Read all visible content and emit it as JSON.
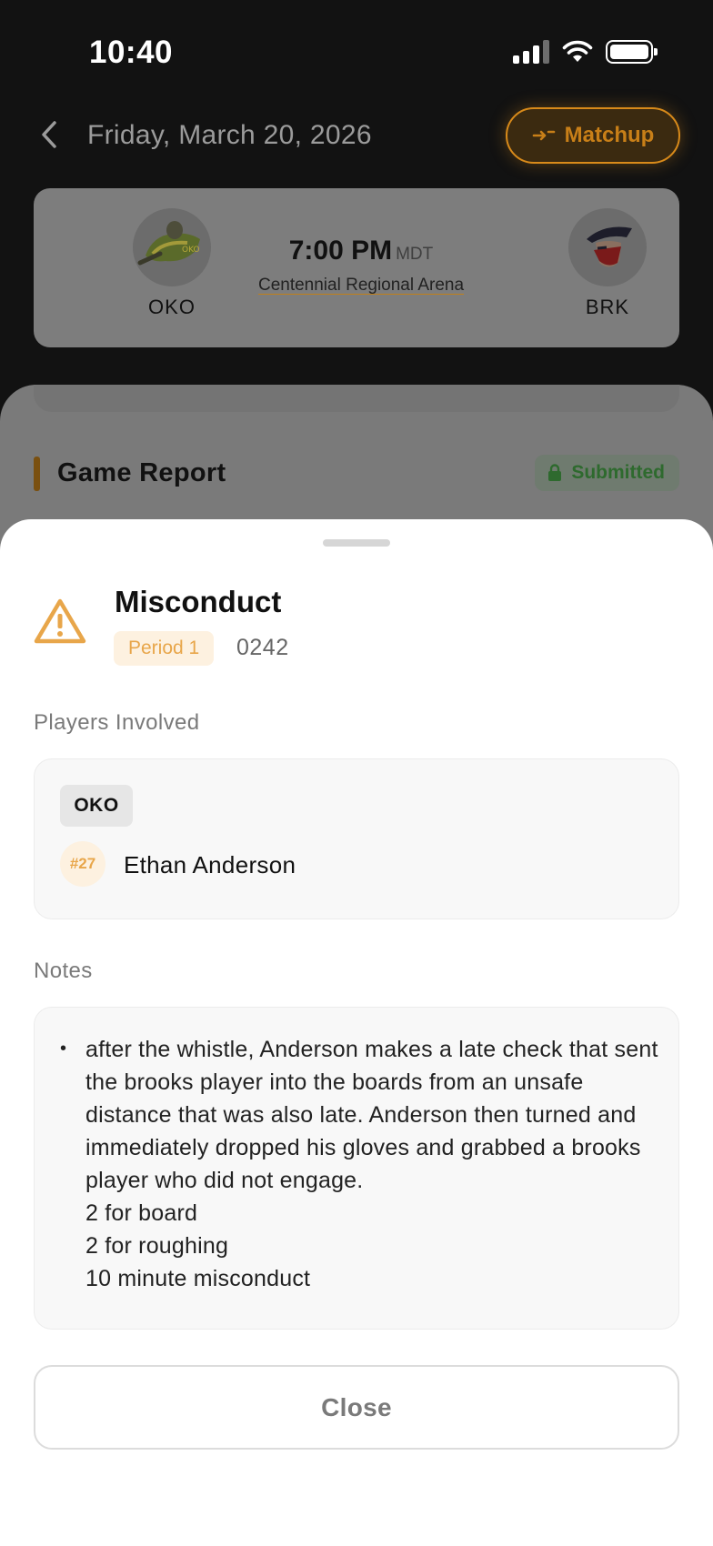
{
  "status_bar": {
    "time": "10:40"
  },
  "header": {
    "title": "Friday, March 20, 2026",
    "matchup_label": "Matchup"
  },
  "game": {
    "home_abbr": "OKO",
    "away_abbr": "BRK",
    "time": "7:00 PM",
    "timezone": "MDT",
    "venue": "Centennial Regional Arena"
  },
  "report": {
    "title": "Game Report",
    "status": "Submitted"
  },
  "sheet": {
    "title": "Misconduct",
    "period": "Period 1",
    "event_time": "0242",
    "players_label": "Players Involved",
    "players": [
      {
        "team": "OKO",
        "number": "#27",
        "name": "Ethan Anderson"
      }
    ],
    "notes_label": "Notes",
    "notes": "after the whistle, Anderson makes a late check that sent the brooks player into the boards from an unsafe distance that was also late. Anderson then turned and immediately dropped his gloves and grabbed a brooks player who did not engage.\n2 for board\n2 for roughing\n10 minute misconduct",
    "close_label": "Close"
  },
  "colors": {
    "accent": "#E8A64A",
    "matchup_orange": "#D88A1A",
    "submitted_green": "#2E6A2E",
    "warning": "#E8A64A"
  }
}
